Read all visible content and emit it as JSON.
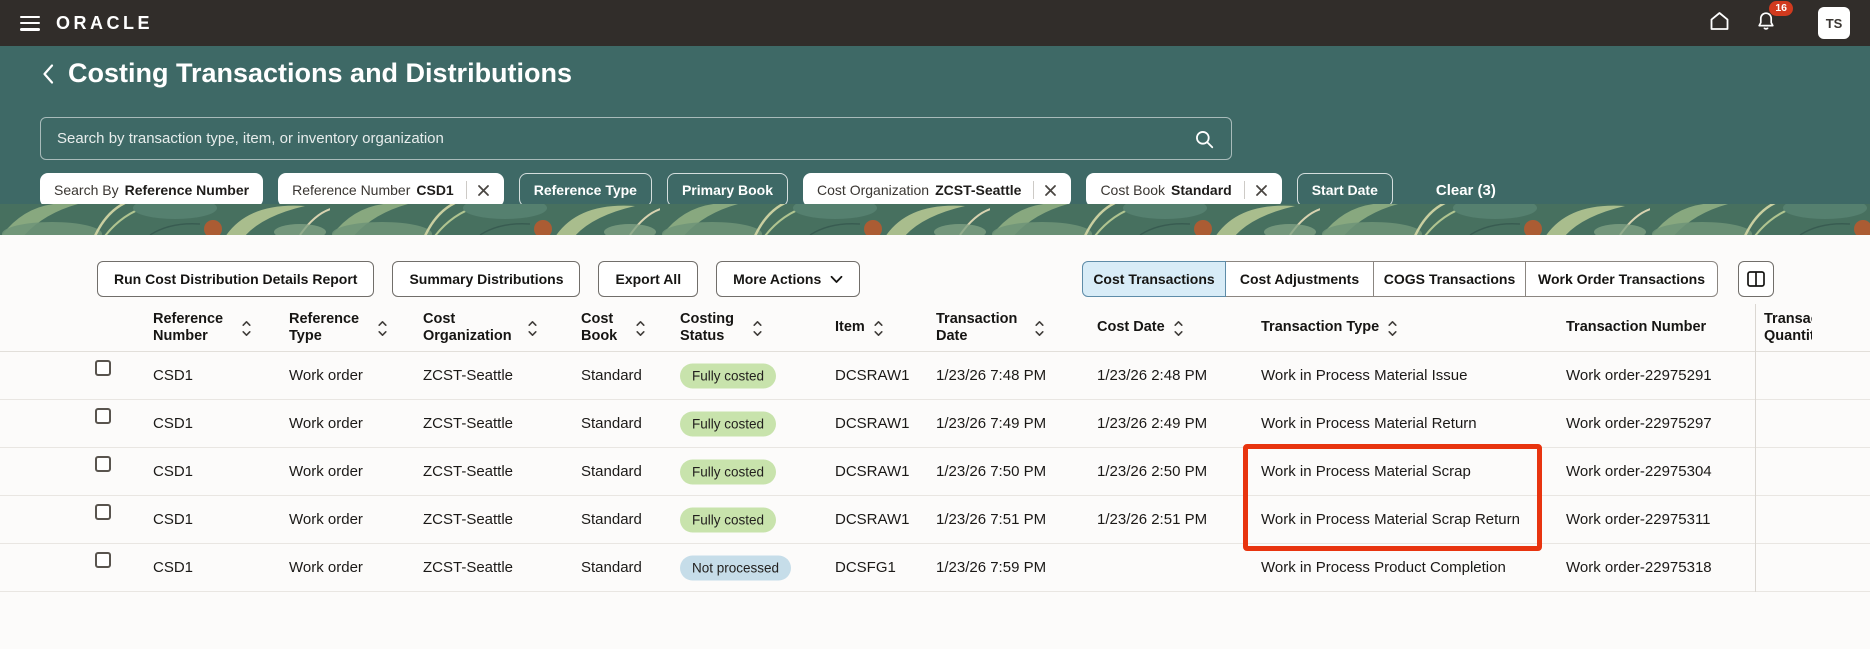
{
  "topbar": {
    "brand": "ORACLE",
    "notification_count": "16",
    "avatar_initials": "TS"
  },
  "page": {
    "title": "Costing Transactions and Distributions"
  },
  "search": {
    "placeholder": "Search by transaction type, item, or inventory organization"
  },
  "filters": {
    "chips": [
      {
        "style": "filled",
        "label": "Search By",
        "value": "Reference Number",
        "closable": false
      },
      {
        "style": "filled",
        "label": "Reference Number",
        "value": "CSD1",
        "closable": true
      },
      {
        "style": "outline",
        "label": "Reference Type",
        "value": "",
        "closable": false
      },
      {
        "style": "outline",
        "label": "Primary Book",
        "value": "",
        "closable": false
      },
      {
        "style": "filled",
        "label": "Cost Organization",
        "value": "ZCST-Seattle",
        "closable": true
      },
      {
        "style": "filled",
        "label": "Cost Book",
        "value": "Standard",
        "closable": true
      },
      {
        "style": "outline",
        "label": "Start Date",
        "value": "",
        "closable": false
      }
    ],
    "clear_label": "Clear (3)"
  },
  "toolbar": {
    "buttons": {
      "run_report": "Run Cost Distribution Details Report",
      "summary_distributions": "Summary Distributions",
      "export_all": "Export All",
      "more_actions": "More Actions"
    },
    "tabs": [
      {
        "label": "Cost Transactions",
        "selected": true
      },
      {
        "label": "Cost Adjustments",
        "selected": false
      },
      {
        "label": "COGS Transactions",
        "selected": false
      },
      {
        "label": "Work Order Transactions",
        "selected": false
      }
    ]
  },
  "table": {
    "columns": [
      {
        "label": "Reference Number",
        "sortable": true
      },
      {
        "label": "Reference Type",
        "sortable": true
      },
      {
        "label": "Cost Organization",
        "sortable": true
      },
      {
        "label": "Cost Book",
        "sortable": true
      },
      {
        "label": "Costing Status",
        "sortable": true
      },
      {
        "label": "Item",
        "sortable": true
      },
      {
        "label": "Transaction Date",
        "sortable": true
      },
      {
        "label": "Cost Date",
        "sortable": true
      },
      {
        "label": "Transaction Type",
        "sortable": true
      },
      {
        "label": "Transaction Number",
        "sortable": false
      },
      {
        "label": "Transaction Quantity",
        "sortable": false,
        "clipped": true
      }
    ],
    "rows": [
      {
        "reference_number": "CSD1",
        "reference_type": "Work order",
        "cost_organization": "ZCST-Seattle",
        "cost_book": "Standard",
        "costing_status": "Fully costed",
        "status_kind": "fully-costed",
        "item": "DCSRAW1",
        "transaction_date": "1/23/26 7:48 PM",
        "cost_date": "1/23/26 2:48 PM",
        "transaction_type": "Work in Process Material Issue",
        "transaction_number": "Work order-22975291"
      },
      {
        "reference_number": "CSD1",
        "reference_type": "Work order",
        "cost_organization": "ZCST-Seattle",
        "cost_book": "Standard",
        "costing_status": "Fully costed",
        "status_kind": "fully-costed",
        "item": "DCSRAW1",
        "transaction_date": "1/23/26 7:49 PM",
        "cost_date": "1/23/26 2:49 PM",
        "transaction_type": "Work in Process Material Return",
        "transaction_number": "Work order-22975297"
      },
      {
        "reference_number": "CSD1",
        "reference_type": "Work order",
        "cost_organization": "ZCST-Seattle",
        "cost_book": "Standard",
        "costing_status": "Fully costed",
        "status_kind": "fully-costed",
        "item": "DCSRAW1",
        "transaction_date": "1/23/26 7:50 PM",
        "cost_date": "1/23/26 2:50 PM",
        "transaction_type": "Work in Process Material Scrap",
        "transaction_number": "Work order-22975304"
      },
      {
        "reference_number": "CSD1",
        "reference_type": "Work order",
        "cost_organization": "ZCST-Seattle",
        "cost_book": "Standard",
        "costing_status": "Fully costed",
        "status_kind": "fully-costed",
        "item": "DCSRAW1",
        "transaction_date": "1/23/26 7:51 PM",
        "cost_date": "1/23/26 2:51 PM",
        "transaction_type": "Work in Process Material Scrap Return",
        "transaction_number": "Work order-22975311"
      },
      {
        "reference_number": "CSD1",
        "reference_type": "Work order",
        "cost_organization": "ZCST-Seattle",
        "cost_book": "Standard",
        "costing_status": "Not processed",
        "status_kind": "not-processed",
        "item": "DCSFG1",
        "transaction_date": "1/23/26 7:59 PM",
        "cost_date": "",
        "transaction_type": "Work in Process Product Completion",
        "transaction_number": "Work order-22975318"
      }
    ],
    "highlight_note": "red box around Transaction Type of rows 3 and 4"
  },
  "colors": {
    "topbar_bg": "#312D2A",
    "hero_bg": "#3E6966",
    "notification_badge": "#D13A1E",
    "highlight_red": "#E8340F",
    "status_fully_costed": "#C8E3AC",
    "status_not_processed": "#C6DDE9",
    "tab_selected_bg": "#D8ECF7"
  }
}
